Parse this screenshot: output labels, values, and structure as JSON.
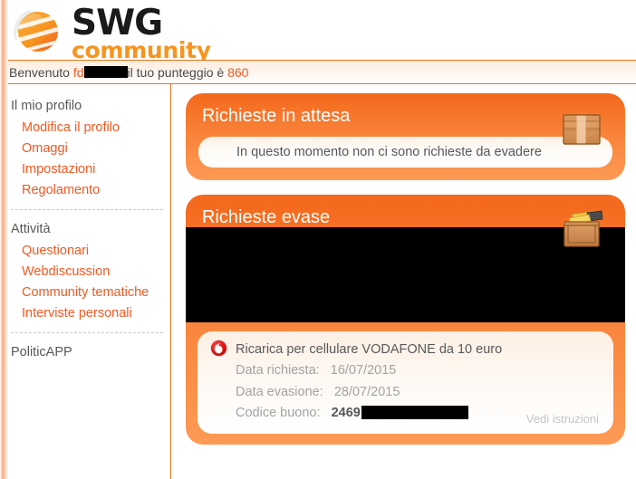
{
  "brand": {
    "name_primary": "SWG",
    "name_secondary": "community",
    "logo_icon": "swg-globe-logo",
    "accent_color": "#f15a22",
    "orange_dark": "#e8751a"
  },
  "welcome": {
    "greeting": "Benvenuto",
    "username_prefix": "fd",
    "username_redacted": true,
    "score_label": "il tuo punteggio è",
    "score": "860"
  },
  "sidebar": {
    "groups": [
      {
        "heading": "Il mio profilo",
        "items": [
          {
            "label": "Modifica il profilo"
          },
          {
            "label": "Omaggi"
          },
          {
            "label": "Impostazioni"
          },
          {
            "label": "Regolamento"
          }
        ]
      },
      {
        "heading": "Attività",
        "items": [
          {
            "label": "Questionari"
          },
          {
            "label": "Webdiscussion"
          },
          {
            "label": "Community tematiche"
          },
          {
            "label": "Interviste personali"
          }
        ]
      },
      {
        "heading": "PoliticAPP",
        "items": []
      }
    ]
  },
  "panels": {
    "pending": {
      "title": "Richieste in attesa",
      "icon": "closed-box-icon",
      "empty_message": "In questo momento non ci sono richieste da evadere"
    },
    "fulfilled": {
      "title": "Richieste evase",
      "icon": "open-crate-icon",
      "redacted_area": true,
      "item": {
        "brand_icon": "vodafone-icon",
        "brand_icon_color": "#e60000",
        "title": "Ricarica per cellulare VODAFONE da 10 euro",
        "request_date_label": "Data richiesta:",
        "request_date": "16/07/2015",
        "fulfill_date_label": "Data evasione:",
        "fulfill_date": "28/07/2015",
        "code_label": "Codice buono:",
        "code_visible": "2469",
        "code_redacted": true,
        "instructions_link": "Vedi istruzioni"
      }
    }
  }
}
